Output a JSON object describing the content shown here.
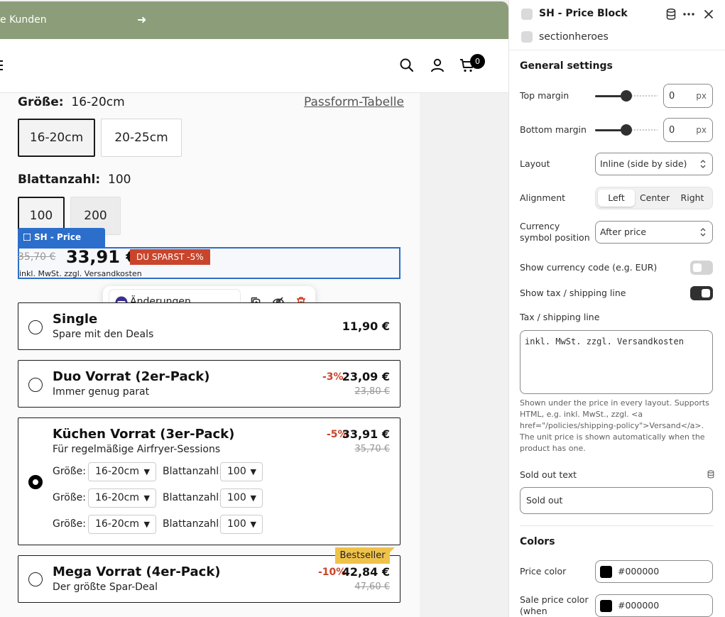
{
  "storefront": {
    "announcement_text": "e Kunden",
    "announcement_arrow": "➜",
    "cart_count": "0",
    "size_label": "Größe:",
    "size_value": "16-20cm",
    "size_guide": "Passform-Tabelle",
    "size_options": [
      "16-20cm",
      "20-25cm"
    ],
    "sheets_label": "Blattanzahl:",
    "sheets_value": "100",
    "sheet_options": [
      "100",
      "200"
    ],
    "price_block_tag": "SH - Price Block",
    "compare_price": "35,70 €",
    "price": "33,91 €",
    "save_badge": "DU SPARST -5%",
    "tax_line": "inkl. MwSt. zzgl. Versandkosten",
    "floating_toolbar": {
      "request_changes": "Änderungen anfordern"
    },
    "bundles": [
      {
        "title": "Single",
        "subtitle": "Spare mit den Deals",
        "price": "11,90 €"
      },
      {
        "title": "Duo Vorrat (2er-Pack)",
        "subtitle": "Immer genug parat",
        "discount": "-3%",
        "price": "23,09 €",
        "compare": "23,80 €"
      },
      {
        "title": "Küchen Vorrat (3er-Pack)",
        "subtitle": "Für regelmäßige Airfryer-Sessions",
        "discount": "-5%",
        "price": "33,91 €",
        "compare": "35,70 €"
      },
      {
        "title": "Mega Vorrat (4er-Pack)",
        "subtitle": "Der größte Spar-Deal",
        "discount": "-10%",
        "price": "42,84 €",
        "compare": "47,60 €",
        "badge": "Bestseller"
      }
    ],
    "variant_rows": [
      {
        "size_label": "Größe:",
        "size": "16-20cm",
        "sheets_label": "Blattanzahl:",
        "sheets": "100"
      },
      {
        "size_label": "Größe:",
        "size": "16-20cm",
        "sheets_label": "Blattanzahl:",
        "sheets": "100"
      },
      {
        "size_label": "Größe:",
        "size": "16-20cm",
        "sheets_label": "Blattanzahl:",
        "sheets": "100"
      }
    ]
  },
  "sidebar": {
    "title": "SH - Price Block",
    "app_name": "sectionheroes",
    "general_title": "General settings",
    "top_margin": {
      "label": "Top margin",
      "value": "0",
      "unit": "px",
      "level": 0.5
    },
    "bottom_margin": {
      "label": "Bottom margin",
      "value": "0",
      "unit": "px",
      "level": 0.5
    },
    "layout": {
      "label": "Layout",
      "value": "Inline (side by side)"
    },
    "alignment": {
      "label": "Alignment",
      "options": [
        "Left",
        "Center",
        "Right"
      ],
      "selected": "Left"
    },
    "currency_position": {
      "label": "Currency symbol position",
      "value": "After price"
    },
    "show_currency_code": {
      "label": "Show currency code (e.g. EUR)",
      "on": false
    },
    "show_tax_line": {
      "label": "Show tax / shipping line",
      "on": true
    },
    "tax_line_field": {
      "label": "Tax / shipping line",
      "value": "inkl. MwSt. zzgl. Versandkosten"
    },
    "tax_help": "Shown under the price in every layout. Supports HTML, e.g. inkl. MwSt., zzgl. <a href=\"/policies/shipping-policy\">Versand</a>. The unit price is shown automatically when the product has one.",
    "sold_out": {
      "label": "Sold out text",
      "value": "Sold out"
    },
    "colors_title": "Colors",
    "price_color": {
      "label": "Price color",
      "value": "#000000"
    },
    "sale_price_color": {
      "label": "Sale price color (when",
      "value": "#000000"
    }
  },
  "colors": {
    "announcement": "#8c9e79",
    "selection": "#2c6ecb",
    "discount": "#c8452c",
    "bestseller": "#efc24a"
  }
}
